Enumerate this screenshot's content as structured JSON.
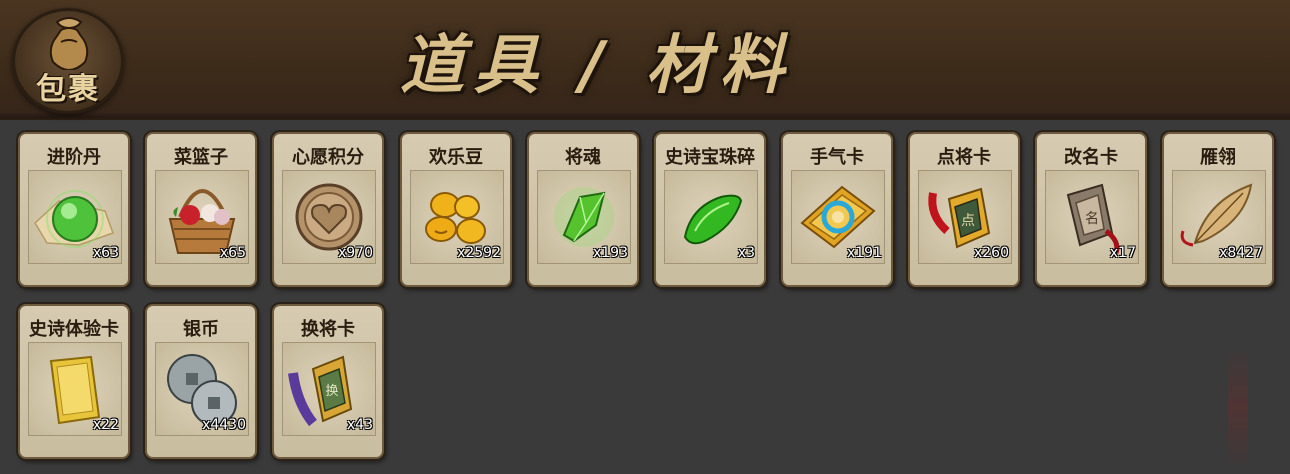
{
  "header": {
    "badge_label": "包裹",
    "title": "道具 / 材料"
  },
  "items": [
    {
      "name": "进阶丹",
      "qty": "x63",
      "icon": "green-pill-icon"
    },
    {
      "name": "菜篮子",
      "qty": "x65",
      "icon": "flower-basket-icon"
    },
    {
      "name": "心愿积分",
      "qty": "x970",
      "icon": "heart-coin-icon"
    },
    {
      "name": "欢乐豆",
      "qty": "x2592",
      "icon": "golden-beans-icon"
    },
    {
      "name": "将魂",
      "qty": "x193",
      "icon": "green-crystal-icon"
    },
    {
      "name": "史诗宝珠碎",
      "qty": "x3",
      "icon": "jade-shard-icon"
    },
    {
      "name": "手气卡",
      "qty": "x191",
      "icon": "luck-card-icon"
    },
    {
      "name": "点将卡",
      "qty": "x260",
      "icon": "general-token-icon"
    },
    {
      "name": "改名卡",
      "qty": "x17",
      "icon": "rename-token-icon"
    },
    {
      "name": "雁翎",
      "qty": "x8427",
      "icon": "feather-icon"
    },
    {
      "name": "史诗体验卡",
      "qty": "x22",
      "icon": "gold-card-icon"
    },
    {
      "name": "银币",
      "qty": "x4430",
      "icon": "silver-coins-icon"
    },
    {
      "name": "换将卡",
      "qty": "x43",
      "icon": "swap-token-icon"
    }
  ],
  "colors": {
    "header_bg": "#3d2b1a",
    "page_bg": "#3a3a3a",
    "card_bg": "#d6cbb1",
    "title_gold": "#d9c08a"
  }
}
